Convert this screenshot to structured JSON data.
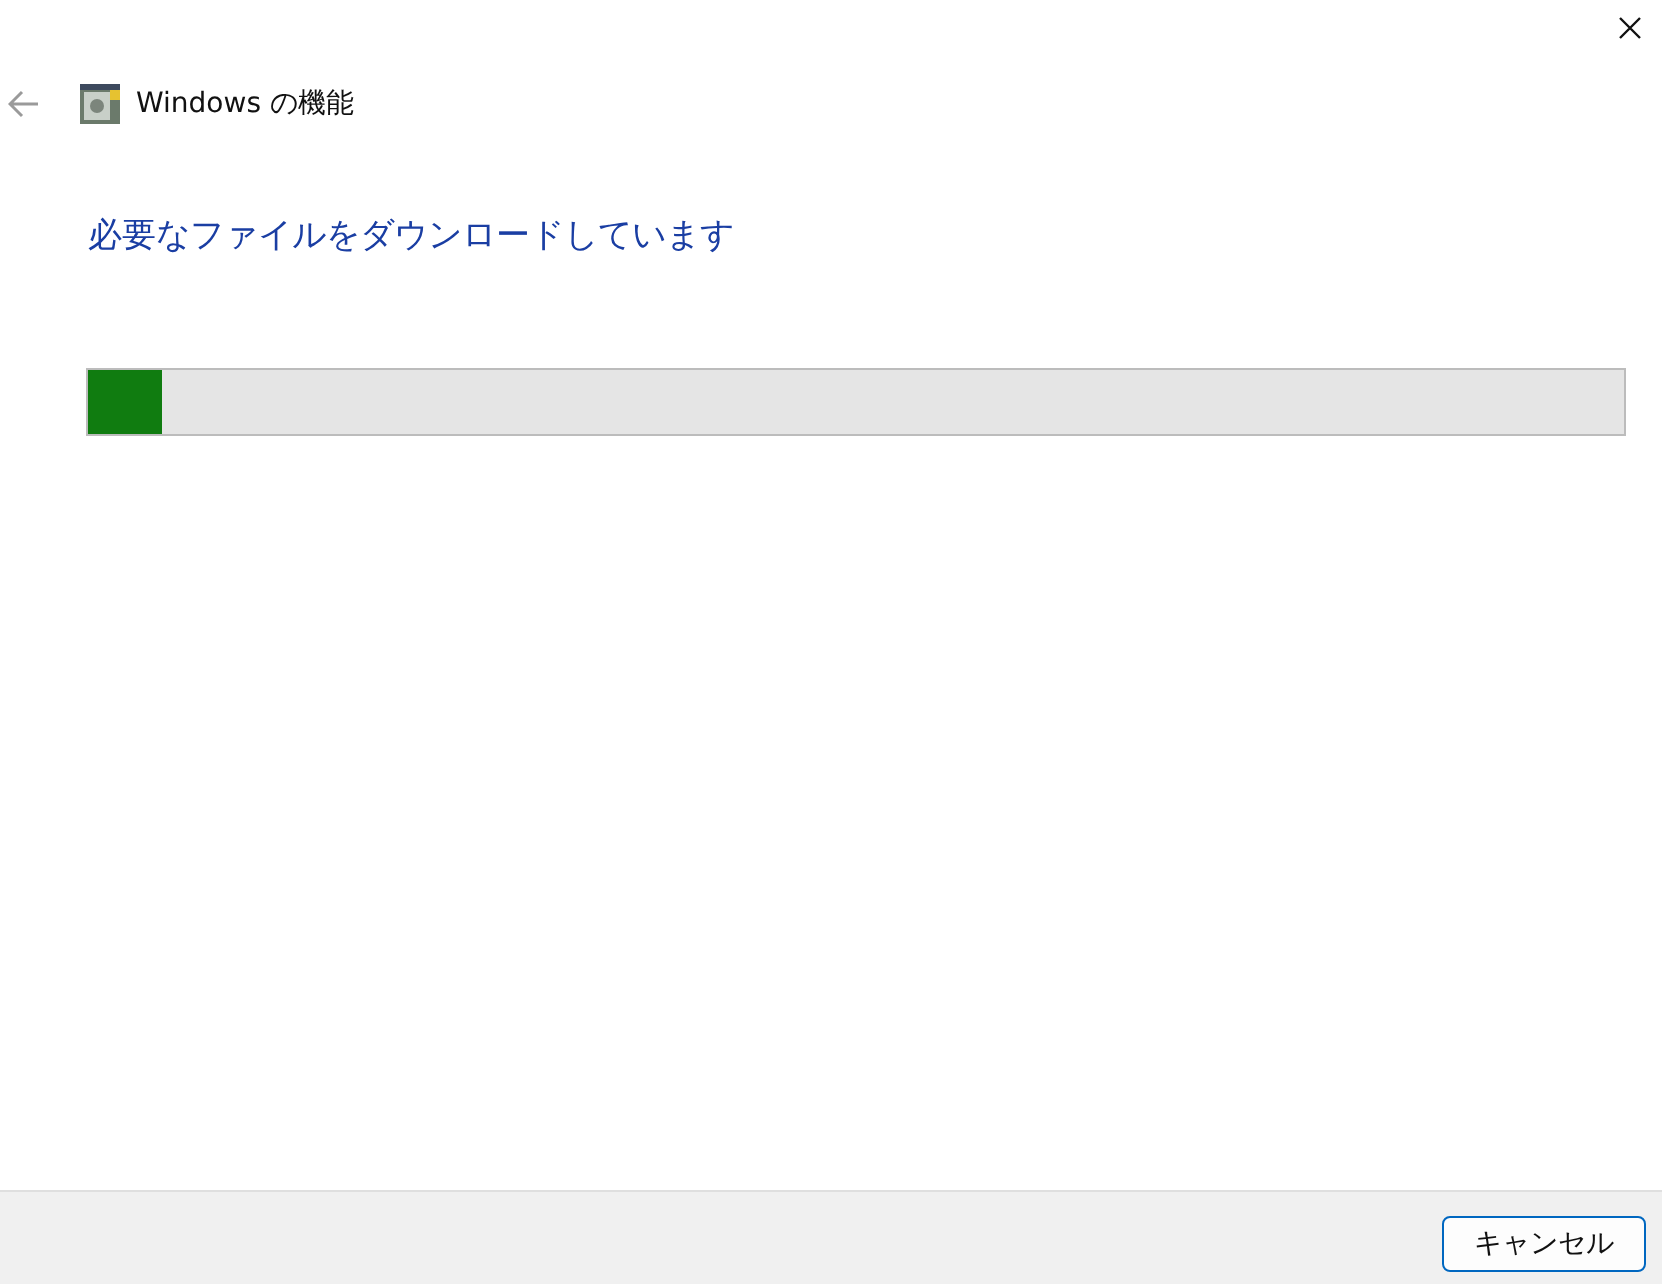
{
  "window": {
    "title": "Windows の機能"
  },
  "heading": "必要なファイルをダウンロードしています",
  "progress": {
    "level": 0.048
  },
  "buttons": [
    {
      "label": "キャンセル"
    }
  ]
}
